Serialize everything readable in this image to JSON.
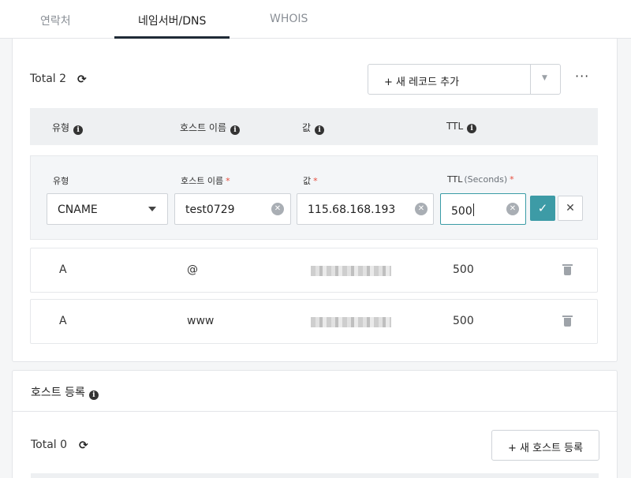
{
  "tabs": [
    {
      "label": "연락처"
    },
    {
      "label": "네임서버/DNS"
    },
    {
      "label": "WHOIS"
    }
  ],
  "records": {
    "total_label": "Total 2",
    "add_button_label": "+ 새 레코드 추가",
    "more_label": "···",
    "columns": [
      "유형",
      "호스트 이름",
      "값",
      "TTL"
    ],
    "edit": {
      "type_label": "유형",
      "host_label": "호스트 이름",
      "value_label": "값",
      "ttl_label": "TTL",
      "ttl_sub": "(Seconds)",
      "required_mark": "*",
      "type_value": "CNAME",
      "host_value": "test0729",
      "value_value": "115.68.168.193",
      "ttl_value": "500"
    },
    "rows": [
      {
        "type": "A",
        "host": "@",
        "ttl": "500"
      },
      {
        "type": "A",
        "host": "www",
        "ttl": "500"
      }
    ]
  },
  "hosts": {
    "title": "호스트 등록",
    "total_label": "Total 0",
    "add_button_label": "+ 새 호스트 등록"
  },
  "colors": {
    "accent": "#3d9ba6",
    "required": "#e74c3c",
    "active_tab_underline": "#1f2a36"
  },
  "icons": [
    "refresh-icon",
    "info-icon",
    "chevron-down-icon",
    "clear-icon",
    "check-icon",
    "close-icon",
    "trash-icon",
    "more-icon"
  ]
}
